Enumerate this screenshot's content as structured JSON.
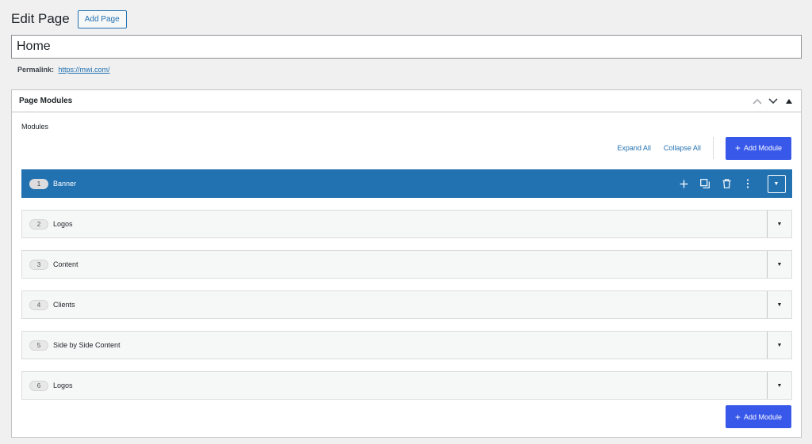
{
  "header": {
    "title": "Edit Page",
    "add_page_label": "Add Page"
  },
  "title_input": {
    "value": "Home"
  },
  "permalink": {
    "label": "Permalink:",
    "url": "https://mwi.com/"
  },
  "postbox": {
    "title": "Page Modules",
    "modules_label": "Modules",
    "expand_all": "Expand All",
    "collapse_all": "Collapse All",
    "add_module_label": "Add Module",
    "modules": [
      {
        "number": "1",
        "name": "Banner",
        "active": true
      },
      {
        "number": "2",
        "name": "Logos",
        "active": false
      },
      {
        "number": "3",
        "name": "Content",
        "active": false
      },
      {
        "number": "4",
        "name": "Clients",
        "active": false
      },
      {
        "number": "5",
        "name": "Side by Side Content",
        "active": false
      },
      {
        "number": "6",
        "name": "Logos",
        "active": false
      }
    ]
  },
  "colors": {
    "accent": "#2271b1",
    "primary_button": "#3858e9",
    "background": "#f0f0f1"
  },
  "icons": [
    "chevron-up-icon",
    "chevron-down-icon",
    "collapse-triangle-icon",
    "plus-icon",
    "duplicate-icon",
    "trash-icon",
    "more-vertical-icon",
    "dropdown-triangle-icon"
  ]
}
